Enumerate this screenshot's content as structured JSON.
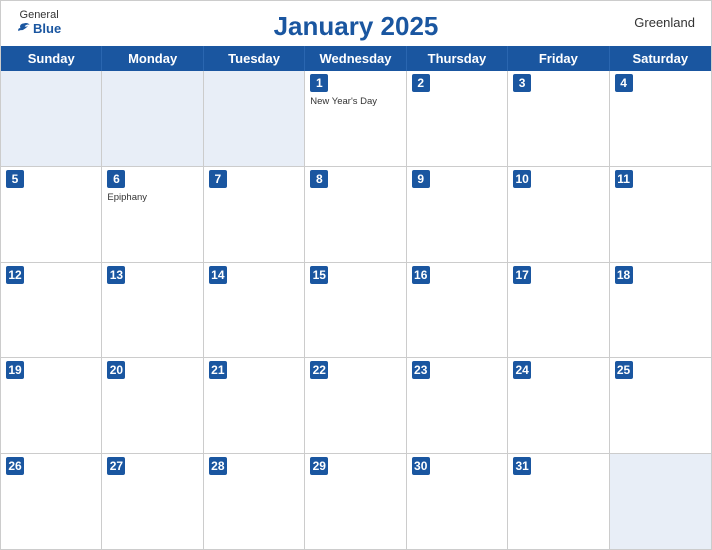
{
  "header": {
    "title": "January 2025",
    "region": "Greenland",
    "logo": {
      "general": "General",
      "blue": "Blue"
    }
  },
  "dayHeaders": [
    "Sunday",
    "Monday",
    "Tuesday",
    "Wednesday",
    "Thursday",
    "Friday",
    "Saturday"
  ],
  "weeks": [
    [
      {
        "day": "",
        "holiday": "",
        "otherMonth": true
      },
      {
        "day": "",
        "holiday": "",
        "otherMonth": true
      },
      {
        "day": "",
        "holiday": "",
        "otherMonth": true
      },
      {
        "day": "1",
        "holiday": "New Year's Day",
        "otherMonth": false
      },
      {
        "day": "2",
        "holiday": "",
        "otherMonth": false
      },
      {
        "day": "3",
        "holiday": "",
        "otherMonth": false
      },
      {
        "day": "4",
        "holiday": "",
        "otherMonth": false
      }
    ],
    [
      {
        "day": "5",
        "holiday": "",
        "otherMonth": false
      },
      {
        "day": "6",
        "holiday": "Epiphany",
        "otherMonth": false
      },
      {
        "day": "7",
        "holiday": "",
        "otherMonth": false
      },
      {
        "day": "8",
        "holiday": "",
        "otherMonth": false
      },
      {
        "day": "9",
        "holiday": "",
        "otherMonth": false
      },
      {
        "day": "10",
        "holiday": "",
        "otherMonth": false
      },
      {
        "day": "11",
        "holiday": "",
        "otherMonth": false
      }
    ],
    [
      {
        "day": "12",
        "holiday": "",
        "otherMonth": false
      },
      {
        "day": "13",
        "holiday": "",
        "otherMonth": false
      },
      {
        "day": "14",
        "holiday": "",
        "otherMonth": false
      },
      {
        "day": "15",
        "holiday": "",
        "otherMonth": false
      },
      {
        "day": "16",
        "holiday": "",
        "otherMonth": false
      },
      {
        "day": "17",
        "holiday": "",
        "otherMonth": false
      },
      {
        "day": "18",
        "holiday": "",
        "otherMonth": false
      }
    ],
    [
      {
        "day": "19",
        "holiday": "",
        "otherMonth": false
      },
      {
        "day": "20",
        "holiday": "",
        "otherMonth": false
      },
      {
        "day": "21",
        "holiday": "",
        "otherMonth": false
      },
      {
        "day": "22",
        "holiday": "",
        "otherMonth": false
      },
      {
        "day": "23",
        "holiday": "",
        "otherMonth": false
      },
      {
        "day": "24",
        "holiday": "",
        "otherMonth": false
      },
      {
        "day": "25",
        "holiday": "",
        "otherMonth": false
      }
    ],
    [
      {
        "day": "26",
        "holiday": "",
        "otherMonth": false
      },
      {
        "day": "27",
        "holiday": "",
        "otherMonth": false
      },
      {
        "day": "28",
        "holiday": "",
        "otherMonth": false
      },
      {
        "day": "29",
        "holiday": "",
        "otherMonth": false
      },
      {
        "day": "30",
        "holiday": "",
        "otherMonth": false
      },
      {
        "day": "31",
        "holiday": "",
        "otherMonth": false
      },
      {
        "day": "",
        "holiday": "",
        "otherMonth": true
      }
    ]
  ]
}
